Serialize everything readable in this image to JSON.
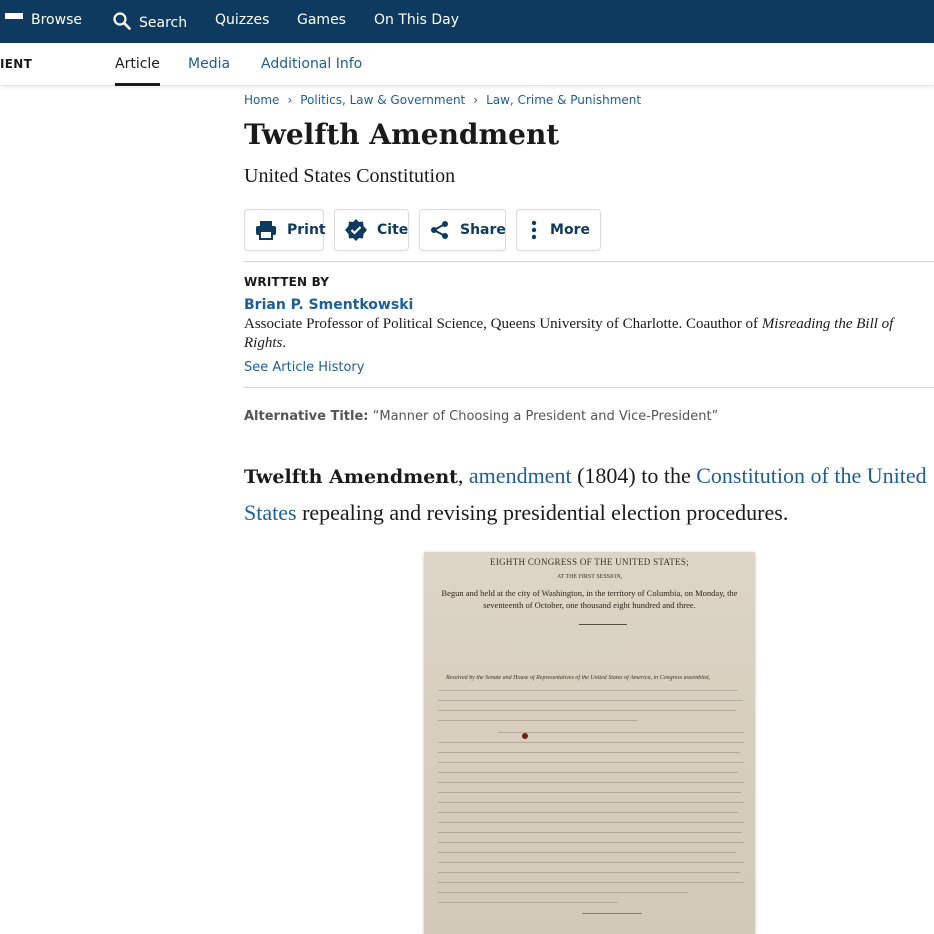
{
  "topnav": {
    "browse": "Browse",
    "search": "Search",
    "quizzes": "Quizzes",
    "games": "Games",
    "on_this_day": "On This Day"
  },
  "subnav": {
    "truncated_title": "IENT",
    "tabs": [
      {
        "label": "Article",
        "active": true
      },
      {
        "label": "Media",
        "active": false
      },
      {
        "label": "Additional Info",
        "active": false
      }
    ]
  },
  "breadcrumb": [
    "Home",
    "Politics, Law & Government",
    "Law, Crime & Punishment"
  ],
  "article": {
    "title": "Twelfth Amendment",
    "subtitle": "United States Constitution"
  },
  "actions": {
    "print": "Print",
    "cite": "Cite",
    "share": "Share",
    "more": "More"
  },
  "byline": {
    "label": "WRITTEN BY",
    "author": "Brian P. Smentkowski",
    "bio_prefix": "Associate Professor of Political Science, Queens University of Charlotte. Coauthor of ",
    "bio_book": "Misreading the Bill of Rights",
    "bio_suffix": ".",
    "history_link": "See Article History"
  },
  "alternative_title": {
    "label": "Alternative Title:",
    "value": "“Manner of Choosing a President and Vice-President”"
  },
  "lead": {
    "term": "Twelfth Amendment",
    "comma": ", ",
    "link1": "amendment",
    "text1": " (1804) to the ",
    "link2": "Constitution of the United States",
    "text2": " repealing and revising presidential election procedures."
  },
  "document_image": {
    "heading": "EIGHTH CONGRESS OF THE UNITED STATES;",
    "session": "AT THE FIRST SESSION,",
    "begun": "Begun and held at the city of Washington, in the territory of Columbia, on Monday, the seventeenth of October, one thousand eight hundred and three.",
    "resolved": "Resolved by the Senate and House of Representatives of the United States of America, in Congress assembled,"
  },
  "colors": {
    "nav_bg": "#0e3a5f",
    "link": "#1b5e9b",
    "text": "#1a1a1a"
  }
}
